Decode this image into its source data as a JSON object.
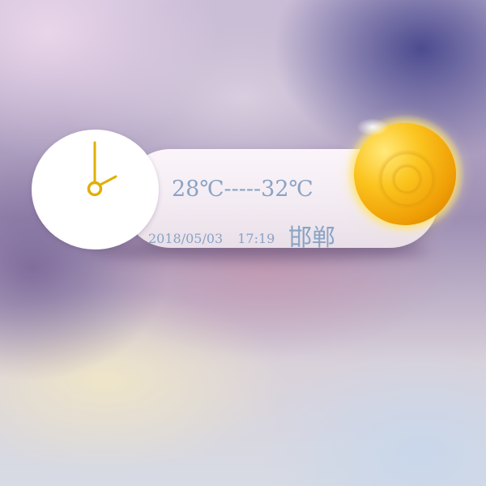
{
  "weather": {
    "temperature_range": "28℃-----32℃",
    "date": "2018/05/03",
    "time": "17:19",
    "city": "邯郸",
    "condition_icon": "sun-icon"
  },
  "clock": {
    "icon": "clock-icon",
    "hand_color": "#e0b000",
    "face_color": "#ffffff"
  },
  "colors": {
    "text": "#8aa3c4",
    "panel": "#f5eef4",
    "sun": "#f7b614"
  }
}
